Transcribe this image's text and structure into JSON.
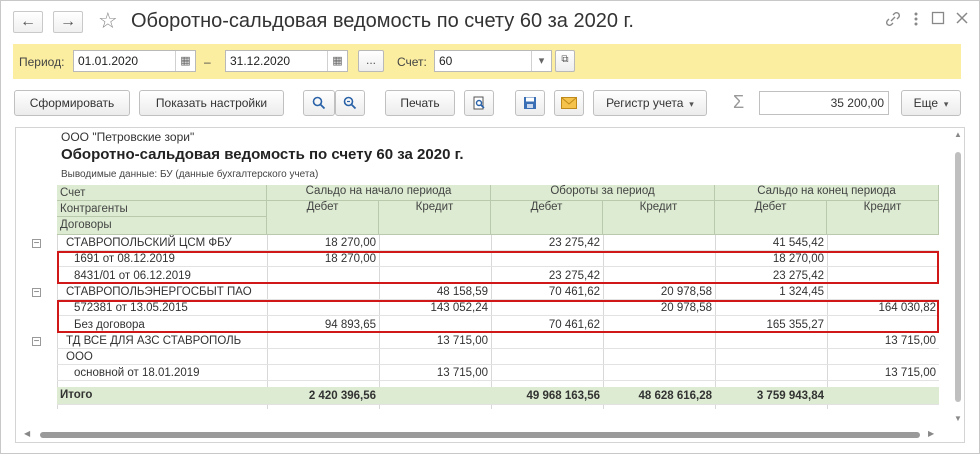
{
  "window": {
    "title": "Оборотно-сальдовая ведомость по счету 60 за 2020 г.",
    "back_icon": "←",
    "forward_icon": "→",
    "star_icon": "☆"
  },
  "filter": {
    "period_label": "Период:",
    "date_from": "01.01.2020",
    "dash": "–",
    "date_to": "31.12.2020",
    "ellipsis": "...",
    "account_label": "Счет:",
    "account_value": "60"
  },
  "toolbar": {
    "generate": "Сформировать",
    "show_settings": "Показать настройки",
    "print": "Печать",
    "register": "Регистр учета",
    "sum_value": "35 200,00",
    "more": "Еще"
  },
  "report": {
    "org": "ООО \"Петровские зори\"",
    "title": "Оборотно-сальдовая ведомость по счету 60 за 2020 г.",
    "subtitle": "Выводимые данные:  БУ (данные бухгалтерского учета)",
    "headers": {
      "account": "Счет",
      "counterparty": "Контрагенты",
      "contracts": "Договоры",
      "opening": "Сальдо на начало периода",
      "turnover": "Обороты за период",
      "closing": "Сальдо на конец периода",
      "debit": "Дебет",
      "credit": "Кредит"
    },
    "rows": [
      {
        "name": "СТАВРОПОЛЬСКИЙ ЦСМ ФБУ",
        "od": "18 270,00",
        "oc": "",
        "td": "23 275,42",
        "tc": "",
        "cd": "41 545,42",
        "cc": ""
      },
      {
        "name": "1691 от 08.12.2019",
        "od": "18 270,00",
        "oc": "",
        "td": "",
        "tc": "",
        "cd": "18 270,00",
        "cc": ""
      },
      {
        "name": "8431/01 от 06.12.2019",
        "od": "",
        "oc": "",
        "td": "23 275,42",
        "tc": "",
        "cd": "23 275,42",
        "cc": ""
      },
      {
        "name": "СТАВРОПОЛЬЭНЕРГОСБЫТ ПАО",
        "od": "",
        "oc": "48 158,59",
        "td": "70 461,62",
        "tc": "20 978,58",
        "cd": "1 324,45",
        "cc": ""
      },
      {
        "name": "572381 от 13.05.2015",
        "od": "",
        "oc": "143 052,24",
        "td": "",
        "tc": "20 978,58",
        "cd": "",
        "cc": "164 030,82"
      },
      {
        "name": "Без договора",
        "od": "94 893,65",
        "oc": "",
        "td": "70 461,62",
        "tc": "",
        "cd": "165 355,27",
        "cc": ""
      },
      {
        "name": "ТД ВСЕ ДЛЯ АЗС СТАВРОПОЛЬ",
        "od": "",
        "oc": "13 715,00",
        "td": "",
        "tc": "",
        "cd": "",
        "cc": "13 715,00"
      },
      {
        "name": "ООО",
        "od": "",
        "oc": "",
        "td": "",
        "tc": "",
        "cd": "",
        "cc": ""
      },
      {
        "name": "основной от 18.01.2019",
        "od": "",
        "oc": "13 715,00",
        "td": "",
        "tc": "",
        "cd": "",
        "cc": "13 715,00"
      }
    ],
    "total": {
      "name": "Итого",
      "od": "2 420 396,56",
      "oc": "",
      "td": "49 968 163,56",
      "tc": "48 628 616,28",
      "cd": "3 759 943,84",
      "cc": ""
    }
  },
  "colors": {
    "filter_bg": "#fbeea1",
    "header_bg": "#dcebd1",
    "highlight": "#d01818"
  }
}
